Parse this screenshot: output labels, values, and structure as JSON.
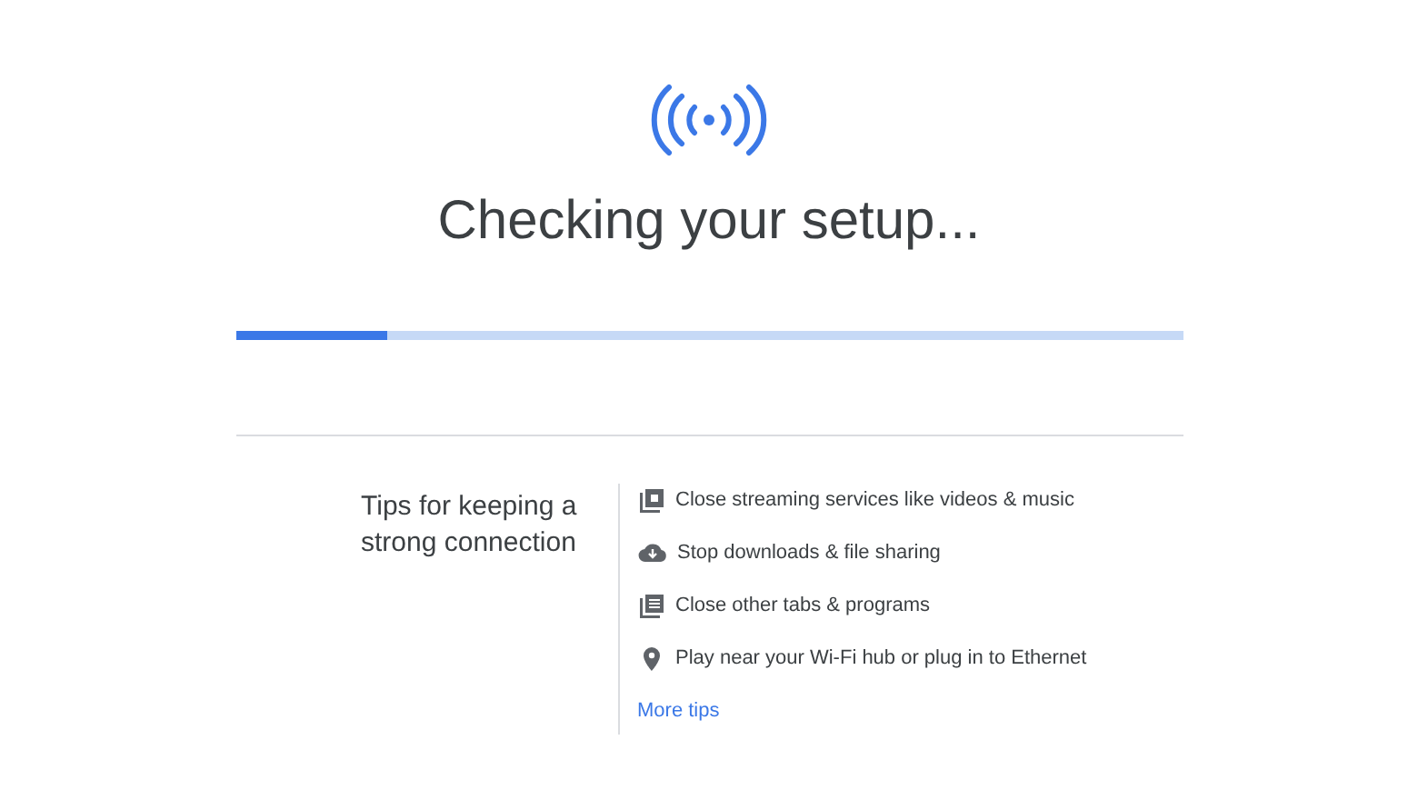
{
  "title": "Checking your setup...",
  "progress": {
    "level": 0.16
  },
  "tips": {
    "heading": "Tips for keeping a strong connection",
    "items": [
      {
        "kind": "media",
        "text": "Close streaming services like videos & music"
      },
      {
        "kind": "download",
        "text": "Stop downloads & file sharing"
      },
      {
        "kind": "tabs",
        "text": "Close other tabs & programs"
      },
      {
        "kind": "location",
        "text": "Play near your Wi-Fi hub or plug in to Ethernet"
      }
    ],
    "link": "More tips"
  }
}
